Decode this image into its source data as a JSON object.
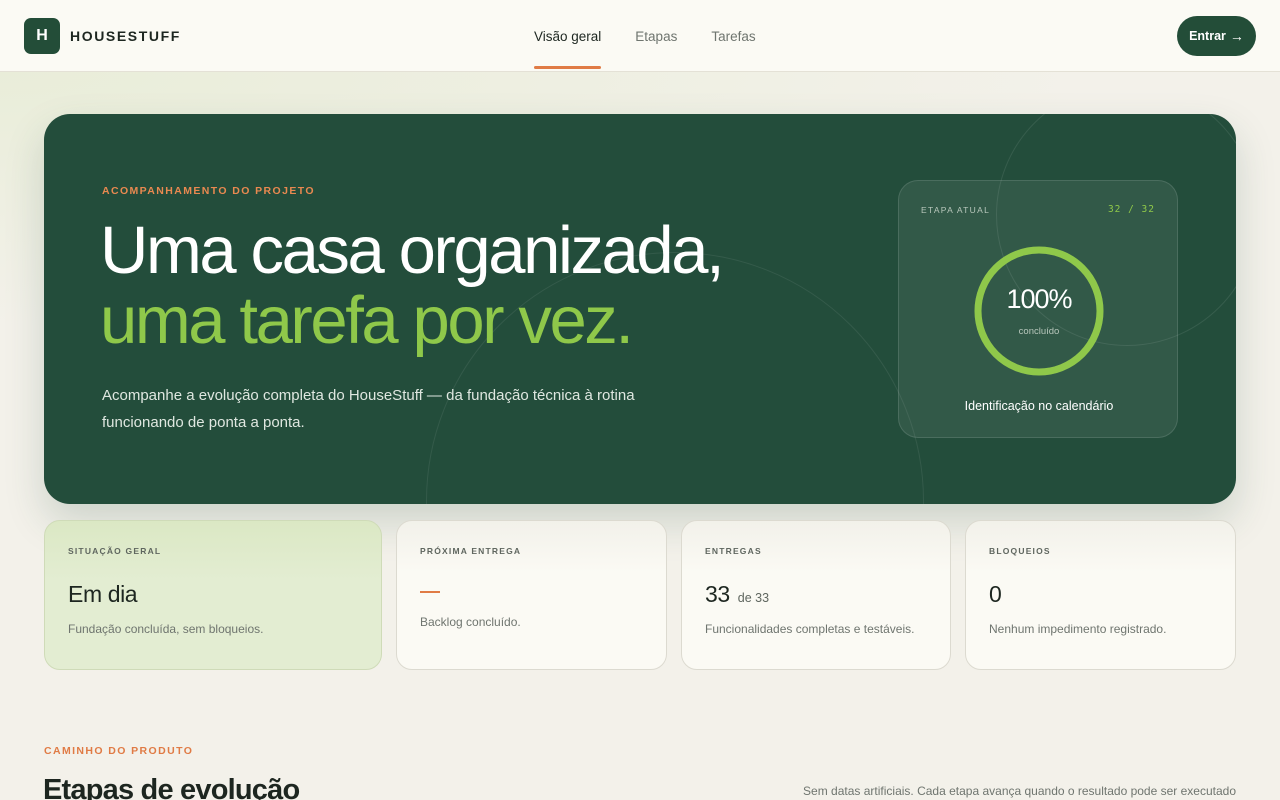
{
  "brand": {
    "mark": "H",
    "name": "HOUSESTUFF",
    "color": "#234d38"
  },
  "nav": {
    "tabs": [
      {
        "label": "Visão geral",
        "active": true
      },
      {
        "label": "Etapas",
        "active": false
      },
      {
        "label": "Tarefas",
        "active": false
      }
    ],
    "login_label": "Entrar",
    "login_icon": "arrow-right-icon"
  },
  "hero": {
    "eyebrow": "ACOMPANHAMENTO DO PROJETO",
    "title_line1": "Uma casa organizada,",
    "title_line2": "uma tarefa por vez.",
    "description": "Acompanhe a evolução completa do HouseStuff — da fundação técnica à rotina funcionando de ponta a ponta.",
    "stage_card": {
      "label": "ETAPA ATUAL",
      "count": "32 / 32",
      "progress_fraction": 1.0,
      "percent_text": "100%",
      "caption": "concluído",
      "stage_name": "Identificação no calendário"
    }
  },
  "stats": [
    {
      "label": "SITUAÇÃO GERAL",
      "value": "Em dia",
      "description": "Fundação concluída, sem bloqueios."
    },
    {
      "label": "PRÓXIMA ENTREGA",
      "value": "—",
      "description": "Backlog concluído."
    },
    {
      "label": "ENTREGAS",
      "value": "33",
      "value_suffix": "de 33",
      "description": "Funcionalidades completas e testáveis."
    },
    {
      "label": "BLOQUEIOS",
      "value": "0",
      "description": "Nenhum impedimento registrado."
    }
  ],
  "section": {
    "eyebrow": "CAMINHO DO PRODUTO",
    "title": "Etapas de evolução",
    "note": "Sem datas artificiais. Cada etapa avança quando o resultado pode ser executado"
  },
  "colors": {
    "accent_orange": "#e07b45",
    "accent_green": "#8fc84a",
    "hero_bg": "#234d3b",
    "page_bg": "#f3f1ea"
  }
}
